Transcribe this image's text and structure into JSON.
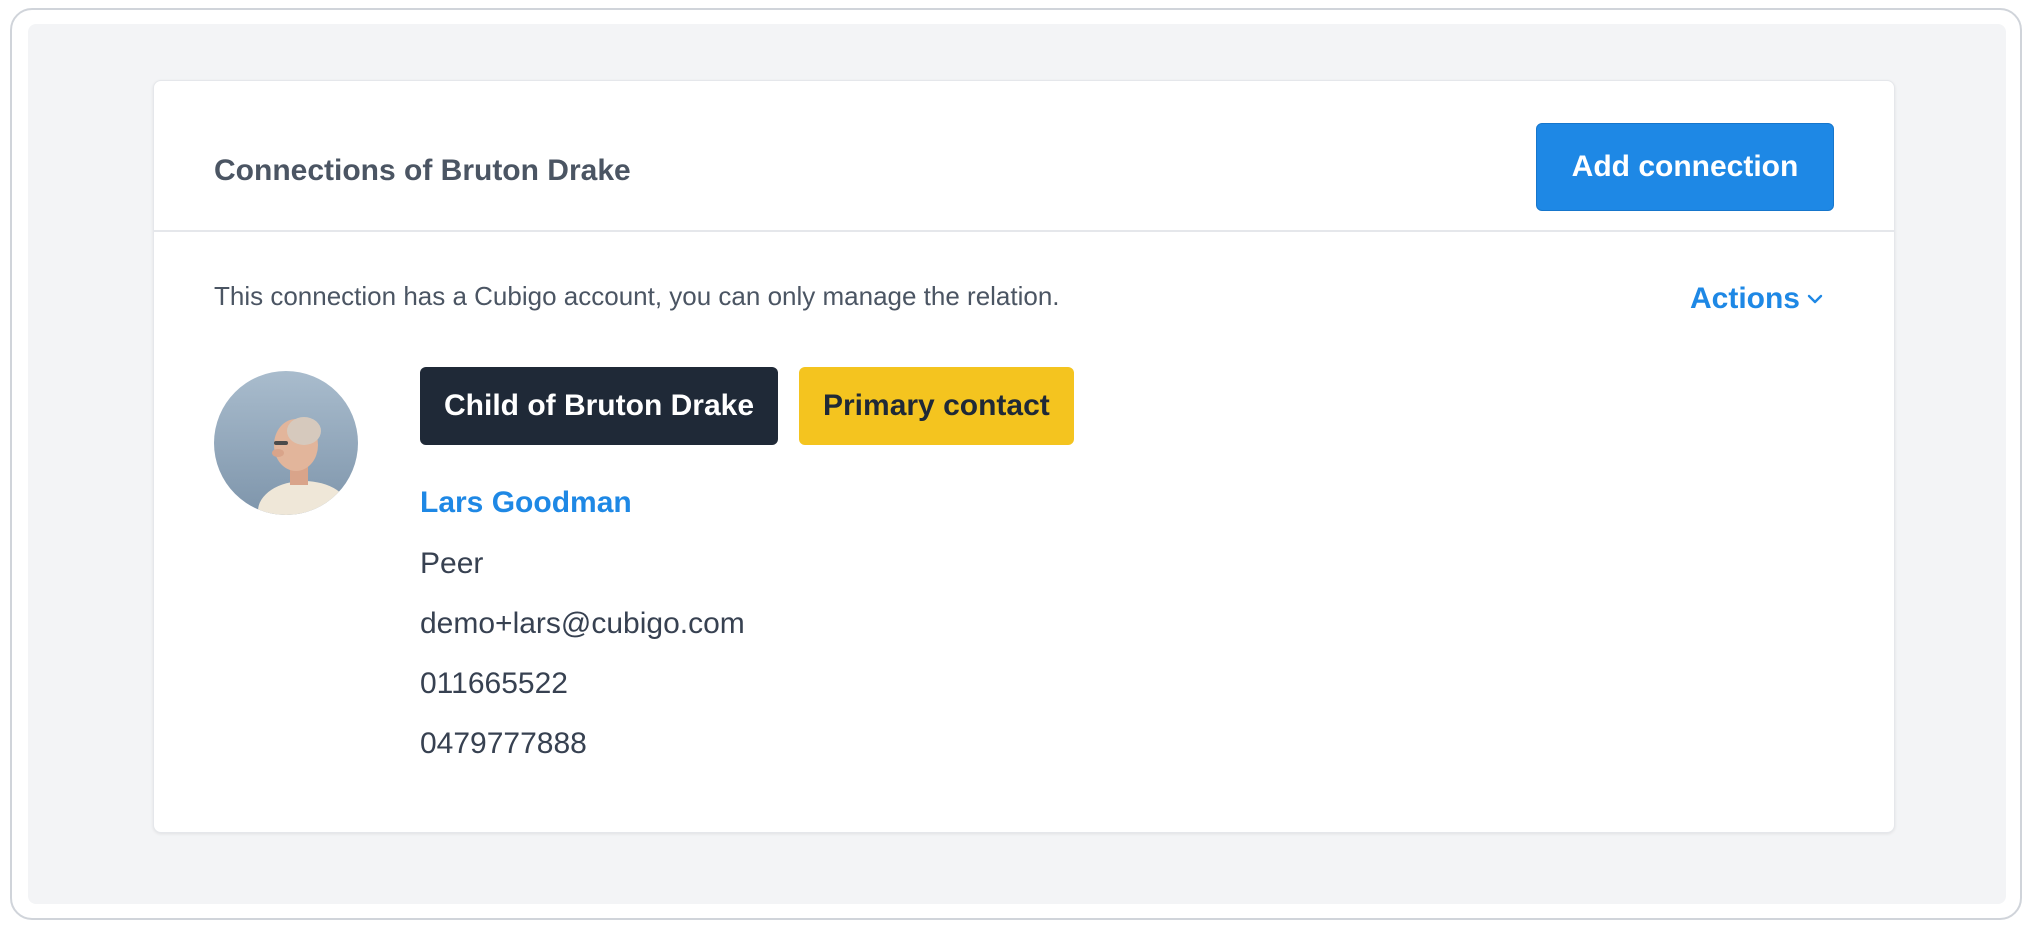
{
  "card": {
    "title": "Connections of Bruton Drake",
    "add_button_label": "Add connection"
  },
  "info": {
    "message": "This connection has a Cubigo account, you can only manage the relation.",
    "actions_label": "Actions"
  },
  "connection": {
    "badges": [
      {
        "label": "Child of Bruton Drake",
        "color": "#1f2937"
      },
      {
        "label": "Primary contact",
        "color": "#f4c41f"
      }
    ],
    "name": "Lars Goodman",
    "relation": "Peer",
    "email": "demo+lars@cubigo.com",
    "phone": "011665522",
    "mobile": "0479777888"
  },
  "colors": {
    "accent": "#1e88e5",
    "background": "#f3f4f6"
  }
}
